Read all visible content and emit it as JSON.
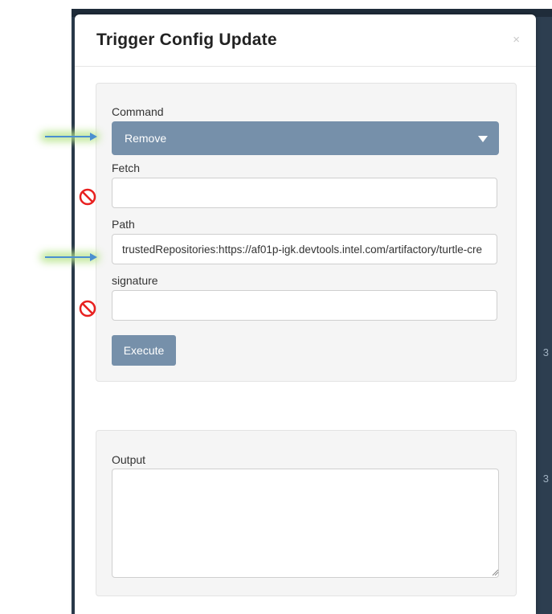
{
  "modal": {
    "title": "Trigger Config Update",
    "close_glyph": "×"
  },
  "form": {
    "command_label": "Command",
    "command_value": "Remove",
    "fetch_label": "Fetch",
    "fetch_value": "",
    "path_label": "Path",
    "path_value": "trustedRepositories:https://af01p-igk.devtools.intel.com/artifactory/turtle-cre",
    "signature_label": "signature",
    "signature_value": "",
    "execute_label": "Execute"
  },
  "output": {
    "label": "Output",
    "value": ""
  },
  "background": {
    "edge_text_1": "3",
    "edge_text_2": "3"
  },
  "annotations": {
    "arrow_color": "#4a8fd0",
    "glow_color": "#b6e48a",
    "no_icon_color": "#e8201f",
    "icons": [
      "arrow-right-icon",
      "no-entry-icon"
    ]
  },
  "colors": {
    "accent": "#7690aa",
    "backdrop": "#2d3e50"
  }
}
